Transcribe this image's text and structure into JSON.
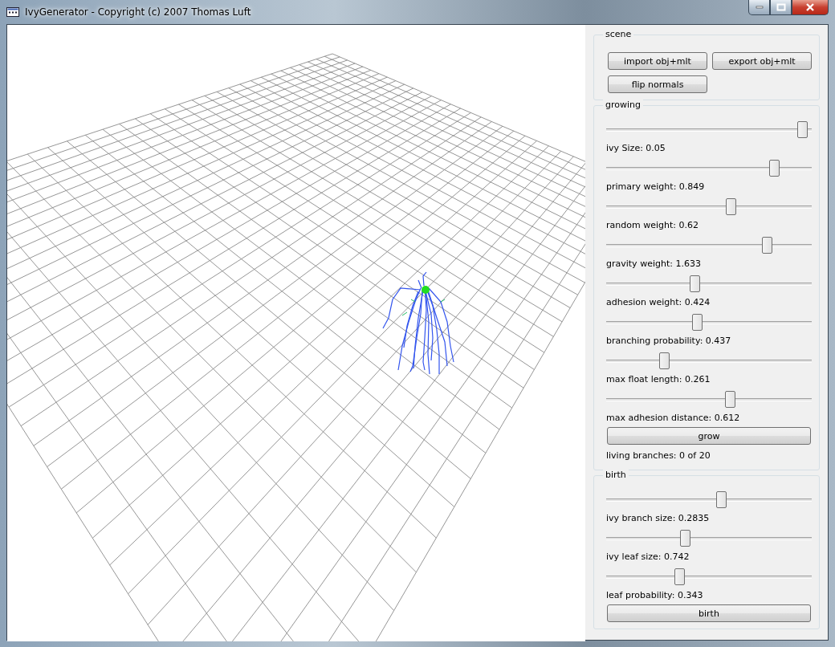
{
  "window": {
    "title": "IvyGenerator  - Copyright (c) 2007 Thomas Luft"
  },
  "groups": [
    {
      "title": "scene",
      "kind": "buttons",
      "buttons": [
        "import obj+mlt",
        "export obj+mlt",
        "flip normals"
      ]
    },
    {
      "title": "growing",
      "kind": "sliders",
      "sliders": [
        {
          "level": 0.98,
          "label": "ivy Size: 0.05"
        },
        {
          "level": 0.835,
          "label": "primary weight: 0.849"
        },
        {
          "level": 0.615,
          "label": "random weight: 0.62"
        },
        {
          "level": 0.8,
          "label": "gravity weight: 1.633"
        },
        {
          "level": 0.43,
          "label": "adhesion weight: 0.424"
        },
        {
          "level": 0.44,
          "label": "branching probability: 0.437"
        },
        {
          "level": 0.27,
          "label": "max float length: 0.261"
        },
        {
          "level": 0.61,
          "label": "max adhesion distance: 0.612"
        }
      ],
      "button": "grow",
      "status": "living branches: 0 of 20"
    },
    {
      "title": "birth",
      "kind": "sliders",
      "sliders": [
        {
          "level": 0.565,
          "label": "ivy branch size: 0.2835"
        },
        {
          "level": 0.38,
          "label": "ivy leaf size: 0.742"
        },
        {
          "level": 0.35,
          "label": "leaf probability: 0.343"
        }
      ],
      "button": "birth"
    }
  ]
}
